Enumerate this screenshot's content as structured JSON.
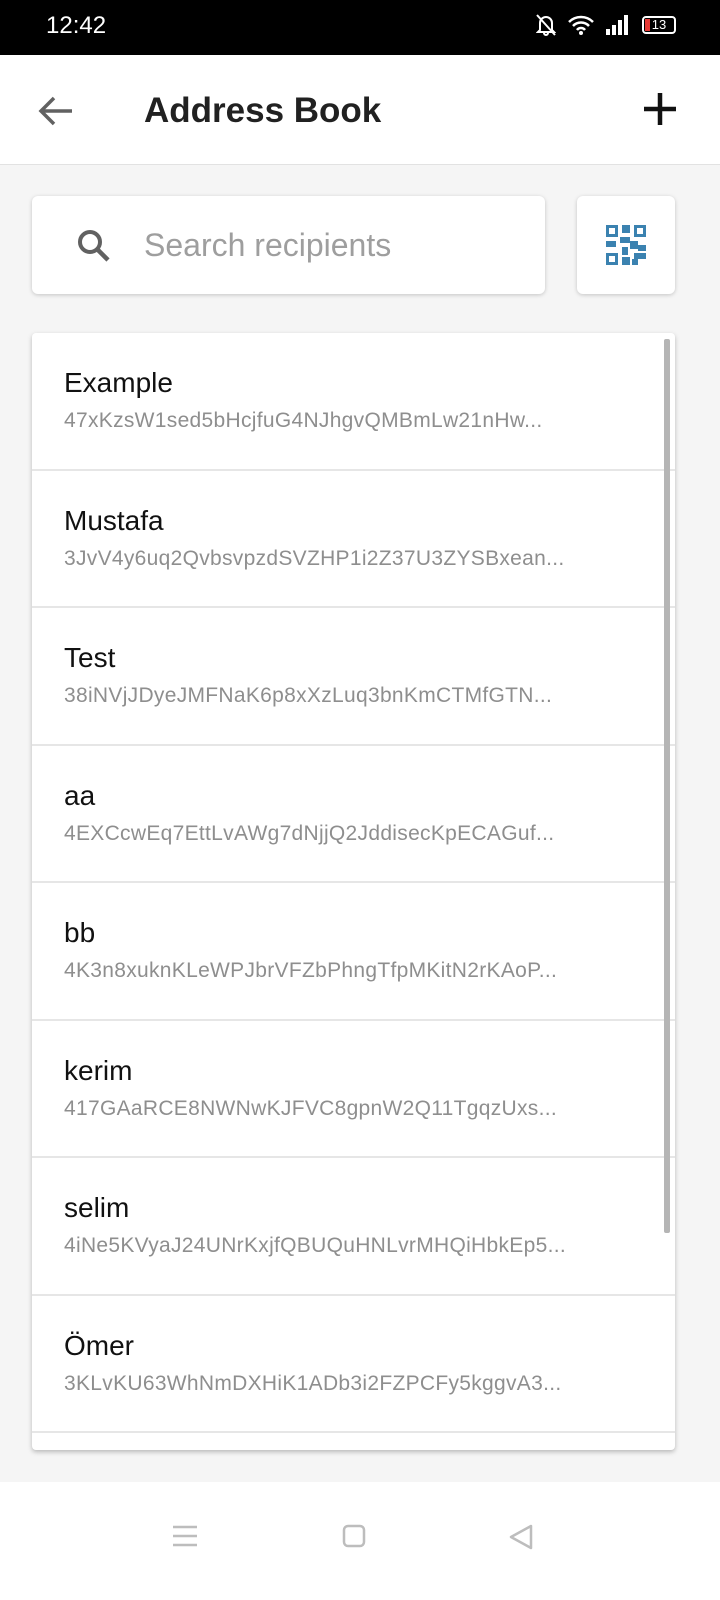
{
  "status_bar": {
    "time": "12:42",
    "battery": "13"
  },
  "header": {
    "title": "Address Book"
  },
  "search": {
    "placeholder": "Search recipients",
    "value": ""
  },
  "recipients": [
    {
      "name": "Example",
      "address": "47xKzsW1sed5bHcjfuG4NJhgvQMBmLw21nHw..."
    },
    {
      "name": "Mustafa",
      "address": "3JvV4y6uq2QvbsvpzdSVZHP1i2Z37U3ZYSBxean..."
    },
    {
      "name": "Test",
      "address": "38iNVjJDyeJMFNaK6p8xXzLuq3bnKmCTMfGTN..."
    },
    {
      "name": "aa",
      "address": "4EXCcwEq7EttLvAWg7dNjjQ2JddisecKpECAGuf..."
    },
    {
      "name": "bb",
      "address": "4K3n8xuknKLeWPJbrVFZbPhngTfpMKitN2rKAoP..."
    },
    {
      "name": "kerim",
      "address": "417GAaRCE8NWNwKJFVC8gpnW2Q11TgqzUxs..."
    },
    {
      "name": "selim",
      "address": "4iNe5KVyaJ24UNrKxjfQBUQuHNLvrMHQiHbkEp5..."
    },
    {
      "name": "Ömer",
      "address": "3KLvKU63WhNmDXHiK1ADb3i2FZPCFy5kggvA3..."
    }
  ],
  "colors": {
    "accent": "#3b82b0",
    "battery_low": "#e53935"
  }
}
